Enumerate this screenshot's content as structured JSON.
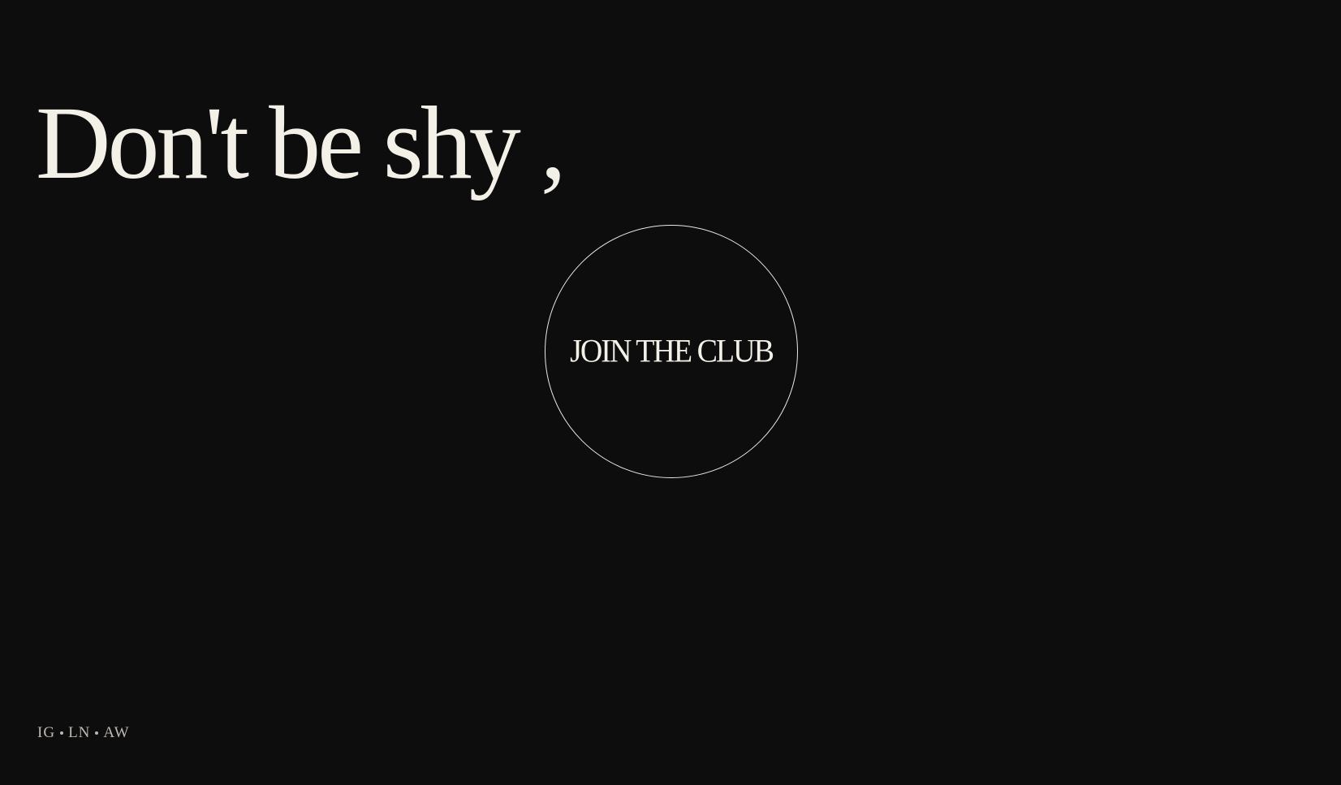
{
  "hero": {
    "headline": "Don't be shy ,"
  },
  "cta": {
    "label": "JOIN THE CLUB"
  },
  "socials": {
    "items": [
      {
        "label": "IG"
      },
      {
        "label": "LN"
      },
      {
        "label": "AW"
      }
    ]
  },
  "colors": {
    "background": "#0d0d0d",
    "text": "#f3f0e8",
    "muted": "#bdb9b0"
  }
}
